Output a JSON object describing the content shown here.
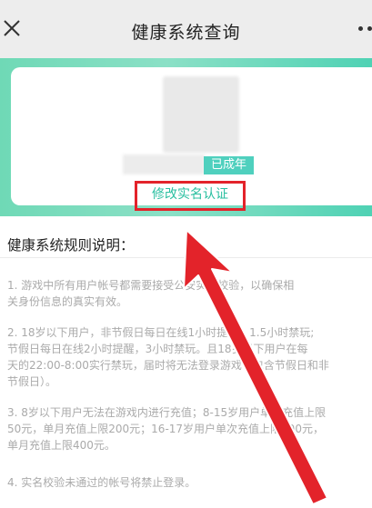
{
  "header": {
    "title": "健康系统查询",
    "close_icon": "close-icon",
    "more_icon": "more-dots-icon"
  },
  "profile": {
    "adult_badge": "已成年",
    "modify_link": "修改实名认证"
  },
  "rules": {
    "title": "健康系统规则说明：",
    "r1": [
      "1. 游戏中所有用户帐号都需要接受公安实名校验，以确保相",
      "关身份信息的真实有效。"
    ],
    "r2": [
      "2. 18岁以下用户，非节假日每日在线1小时提醒，1.5小时禁玩;",
      "节假日每日在线2小时提醒，3小时禁玩。且18岁以下用户在每",
      "天的22:00-8:00实行禁玩，届时将无法登录游戏（包含节假日和非",
      "节假日）。"
    ],
    "r3": [
      "3. 8岁以下用户无法在游戏内进行充值；8-15岁用户单次充值上限",
      "50元，单月充值上限200元；16-17岁用户单次充值上限100元，",
      "单月充值上限400元。"
    ],
    "r4": [
      "4. 实名校验未通过的帐号将禁止登录。"
    ]
  },
  "colors": {
    "accent": "#29bfa0",
    "banner": "#6fd9b6",
    "highlight": "#e3232a"
  }
}
